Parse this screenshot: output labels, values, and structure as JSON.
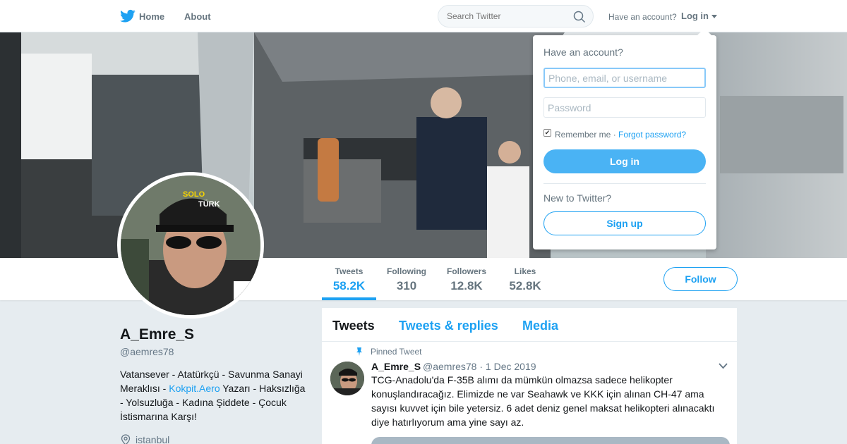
{
  "nav": {
    "home": "Home",
    "about": "About",
    "search_placeholder": "Search Twitter",
    "have_account": "Have an account?",
    "login": "Log in"
  },
  "profile": {
    "name": "A_Emre_S",
    "handle": "@aemres78",
    "bio_before": "Vatansever - Atatürkçü - Savunma Sanayi Meraklısı - ",
    "bio_link": "Kokpit.Aero",
    "bio_after": " Yazarı - Haksızlığa - Yolsuzluğa - Kadına Şiddete - Çocuk İstismarına Karşı!",
    "location": "istanbul"
  },
  "stats": [
    {
      "label": "Tweets",
      "value": "58.2K"
    },
    {
      "label": "Following",
      "value": "310"
    },
    {
      "label": "Followers",
      "value": "12.8K"
    },
    {
      "label": "Likes",
      "value": "52.8K"
    }
  ],
  "follow_label": "Follow",
  "tabs": [
    "Tweets",
    "Tweets & replies",
    "Media"
  ],
  "tweet": {
    "pinned_label": "Pinned Tweet",
    "author": "A_Emre_S",
    "meta": "@aemres78 · 1 Dec 2019",
    "text": "TCG-Anadolu'da F-35B alımı da mümkün olmazsa sadece helikopter konuşlandıracağız. Elimizde ne var Seahawk ve KKK için alınan CH-47 ama sayısı kuvvet için bile yetersiz. 6 adet deniz genel maksat helikopteri alınacaktı diye hatırlıyorum ama yine sayı az."
  },
  "login_dropdown": {
    "title": "Have an account?",
    "username_placeholder": "Phone, email, or username",
    "password_placeholder": "Password",
    "remember": "Remember me",
    "separator": "·",
    "forgot": "Forgot password?",
    "login_button": "Log in",
    "new_to": "New to Twitter?",
    "signup_button": "Sign up"
  },
  "colors": {
    "accent": "#1da1f2",
    "login_button": "#4ab3f4",
    "background": "#e6ecf0"
  }
}
